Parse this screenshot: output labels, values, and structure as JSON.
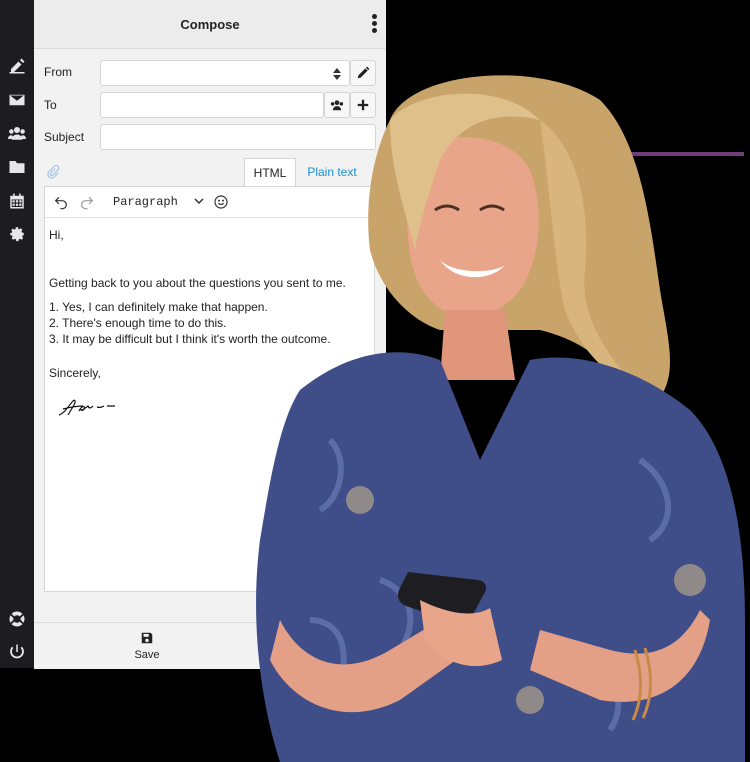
{
  "panel": {
    "title": "Compose",
    "from_label": "From",
    "to_label": "To",
    "subject_label": "Subject",
    "from_value": "",
    "to_value": "",
    "subject_value": ""
  },
  "tabs": [
    {
      "label": "HTML",
      "active": true
    },
    {
      "label": "Plain text",
      "active": false
    }
  ],
  "toolbar": {
    "block_format": "Paragraph"
  },
  "message": {
    "greeting": "Hi,",
    "intro": "Getting back to you about the questions you sent to me.",
    "points": [
      "1. Yes, I can definitely make that happen.",
      "2. There's enough time to do this.",
      "3. It may be difficult but I think it's worth the outcome."
    ],
    "closing": "Sincerely,"
  },
  "footer": {
    "save_label": "Save"
  },
  "icons": {
    "rail_top": [
      "compose-icon",
      "mail-icon",
      "contacts-icon",
      "folder-icon",
      "calendar-icon",
      "settings-icon"
    ],
    "rail_bottom": [
      "help-icon",
      "power-icon"
    ]
  },
  "colors": {
    "rail": "#1d1d1f",
    "panel": "#f2f2f3",
    "link": "#1a91d6",
    "accent": "#6f3e7a",
    "background": "#000000"
  }
}
